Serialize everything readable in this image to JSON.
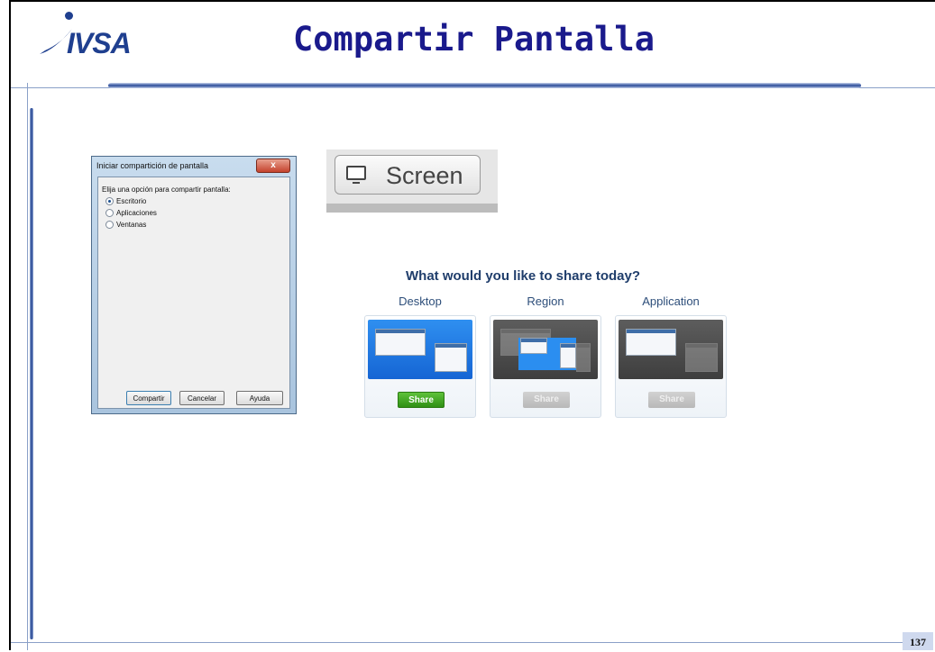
{
  "slide": {
    "logo_text": "IVSA",
    "title": "Compartir Pantalla",
    "page_number": "137"
  },
  "dialog": {
    "title": "Iniciar compartición de pantalla",
    "close_label": "x",
    "prompt": "Elija una opción para compartir pantalla:",
    "options": [
      {
        "label": "Escritorio",
        "selected": true
      },
      {
        "label": "Aplicaciones",
        "selected": false
      },
      {
        "label": "Ventanas",
        "selected": false
      }
    ],
    "buttons": {
      "share": "Compartir",
      "cancel": "Cancelar",
      "help": "Ayuda"
    }
  },
  "screen_button": {
    "label": "Screen",
    "icon": "monitor-icon"
  },
  "share_panel": {
    "heading": "What would you like to share today?",
    "cards": [
      {
        "label": "Desktop",
        "button": "Share",
        "active": true
      },
      {
        "label": "Region",
        "button": "Share",
        "active": false
      },
      {
        "label": "Application",
        "button": "Share",
        "active": false
      }
    ]
  },
  "colors": {
    "title": "#1a1a8c",
    "accent": "#1f3f8f",
    "share_active": "#3a9d1a"
  }
}
